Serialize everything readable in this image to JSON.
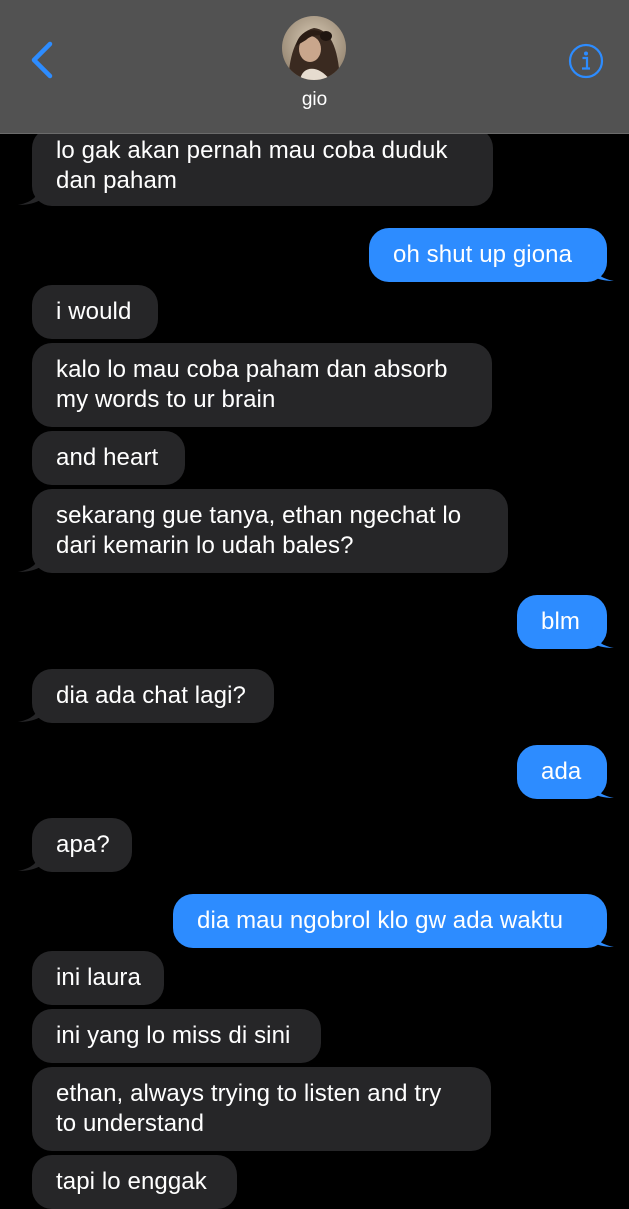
{
  "header": {
    "contact_name": "gio",
    "accent_color": "#2d8cff",
    "back_icon": "chevron-left-icon",
    "info_icon": "info-circle-icon"
  },
  "messages": [
    {
      "from": "them",
      "text": "lo gak akan pernah mau coba duduk\ndan paham"
    },
    {
      "from": "me",
      "text": "oh shut up giona"
    },
    {
      "from": "them",
      "text": "i would"
    },
    {
      "from": "them",
      "text": "kalo lo mau coba paham dan absorb\nmy words to ur brain"
    },
    {
      "from": "them",
      "text": "and heart"
    },
    {
      "from": "them",
      "text": "sekarang gue tanya, ethan ngechat lo\ndari kemarin lo udah bales?"
    },
    {
      "from": "me",
      "text": "blm"
    },
    {
      "from": "them",
      "text": "dia ada chat lagi?"
    },
    {
      "from": "me",
      "text": "ada"
    },
    {
      "from": "them",
      "text": "apa?"
    },
    {
      "from": "me",
      "text": "dia mau ngobrol klo gw ada waktu"
    },
    {
      "from": "them",
      "text": "ini laura"
    },
    {
      "from": "them",
      "text": "ini yang lo miss di sini"
    },
    {
      "from": "them",
      "text": "ethan, always trying to listen and try\nto understand"
    },
    {
      "from": "them",
      "text": "tapi lo enggak"
    }
  ]
}
